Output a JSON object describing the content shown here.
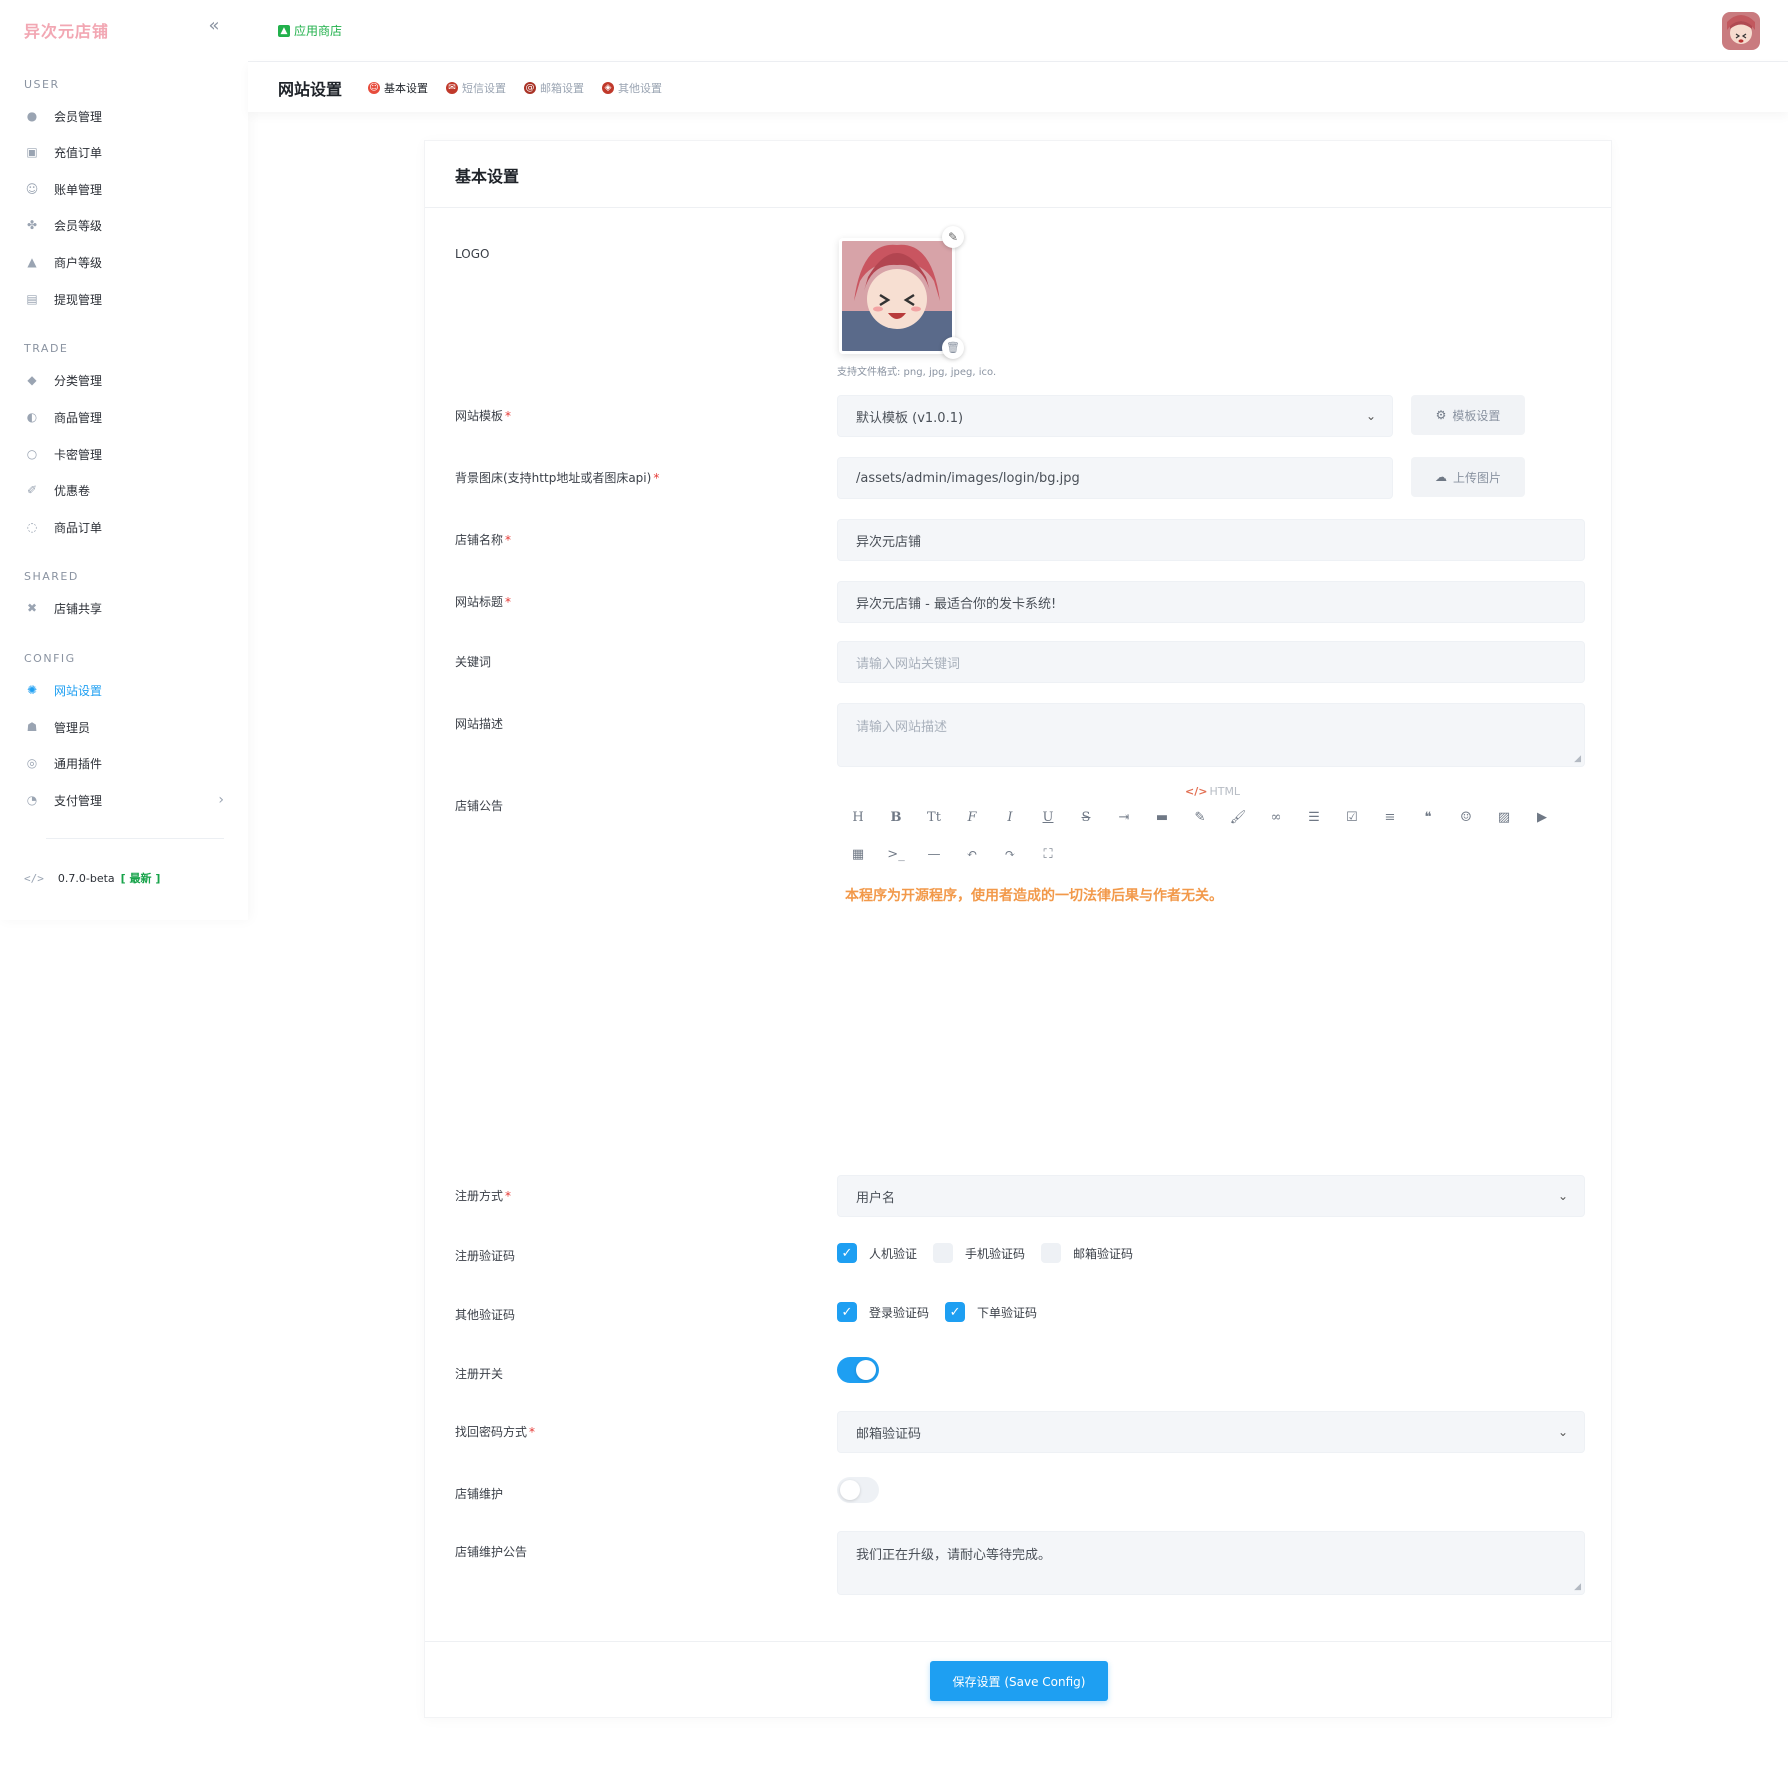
{
  "brand": "异次元店铺",
  "sidebar": {
    "sections": [
      {
        "title": "USER",
        "items": [
          {
            "label": "会员管理",
            "icon": "user-icon"
          },
          {
            "label": "充值订单",
            "icon": "recharge-icon"
          },
          {
            "label": "账单管理",
            "icon": "bill-icon"
          },
          {
            "label": "会员等级",
            "icon": "level-icon"
          },
          {
            "label": "商户等级",
            "icon": "merchant-icon"
          },
          {
            "label": "提现管理",
            "icon": "withdraw-icon"
          }
        ]
      },
      {
        "title": "TRADE",
        "items": [
          {
            "label": "分类管理",
            "icon": "category-icon"
          },
          {
            "label": "商品管理",
            "icon": "goods-icon"
          },
          {
            "label": "卡密管理",
            "icon": "card-icon"
          },
          {
            "label": "优惠卷",
            "icon": "coupon-icon"
          },
          {
            "label": "商品订单",
            "icon": "order-icon"
          }
        ]
      },
      {
        "title": "SHARED",
        "items": [
          {
            "label": "店铺共享",
            "icon": "share-icon"
          }
        ]
      },
      {
        "title": "CONFIG",
        "items": [
          {
            "label": "网站设置",
            "icon": "settings-icon"
          },
          {
            "label": "管理员",
            "icon": "admin-icon"
          },
          {
            "label": "通用插件",
            "icon": "plugin-icon"
          },
          {
            "label": "支付管理",
            "icon": "payment-icon"
          }
        ]
      }
    ],
    "version": "0.7.0-beta",
    "version_tag": "[ 最新 ]"
  },
  "topbar": {
    "appstore": "应用商店"
  },
  "subheader": {
    "title": "网站设置",
    "tabs": [
      {
        "label": "基本设置",
        "active": true
      },
      {
        "label": "短信设置",
        "active": false
      },
      {
        "label": "邮箱设置",
        "active": false
      },
      {
        "label": "其他设置",
        "active": false
      }
    ]
  },
  "card": {
    "title": "基本设置",
    "logo": {
      "label": "LOGO",
      "hint": "支持文件格式: png, jpg, jpeg, ico."
    },
    "template": {
      "label": "网站模板",
      "value": "默认模板 (v1.0.1)",
      "button": "模板设置"
    },
    "background": {
      "label": "背景图床(支持http地址或者图床api)",
      "value": "/assets/admin/images/login/bg.jpg",
      "button": "上传图片"
    },
    "shop_name": {
      "label": "店铺名称",
      "value": "异次元店铺"
    },
    "site_title": {
      "label": "网站标题",
      "value": "异次元店铺 - 最适合你的发卡系统!"
    },
    "keywords": {
      "label": "关键词",
      "placeholder": "请输入网站关键词"
    },
    "description": {
      "label": "网站描述",
      "placeholder": "请输入网站描述"
    },
    "notice": {
      "label": "店铺公告",
      "html_toggle": "HTML",
      "content": "本程序为开源程序，使用者造成的一切法律后果与作者无关。"
    },
    "register_method": {
      "label": "注册方式",
      "value": "用户名"
    },
    "register_captcha": {
      "label": "注册验证码",
      "options": [
        {
          "label": "人机验证",
          "checked": true
        },
        {
          "label": "手机验证码",
          "checked": false
        },
        {
          "label": "邮箱验证码",
          "checked": false
        }
      ]
    },
    "other_captcha": {
      "label": "其他验证码",
      "options": [
        {
          "label": "登录验证码",
          "checked": true
        },
        {
          "label": "下单验证码",
          "checked": true
        }
      ]
    },
    "register_switch": {
      "label": "注册开关",
      "on": true
    },
    "recover_method": {
      "label": "找回密码方式",
      "value": "邮箱验证码"
    },
    "maintenance": {
      "label": "店铺维护",
      "on": false
    },
    "maintenance_notice": {
      "label": "店铺维护公告",
      "value": "我们正在升级，请耐心等待完成。"
    },
    "save_button": "保存设置 (Save Config)"
  },
  "colors": {
    "accent": "#1e9ff2",
    "brand": "#f2a7b3",
    "notice": "#f2994a",
    "appstore": "#22b14c"
  }
}
